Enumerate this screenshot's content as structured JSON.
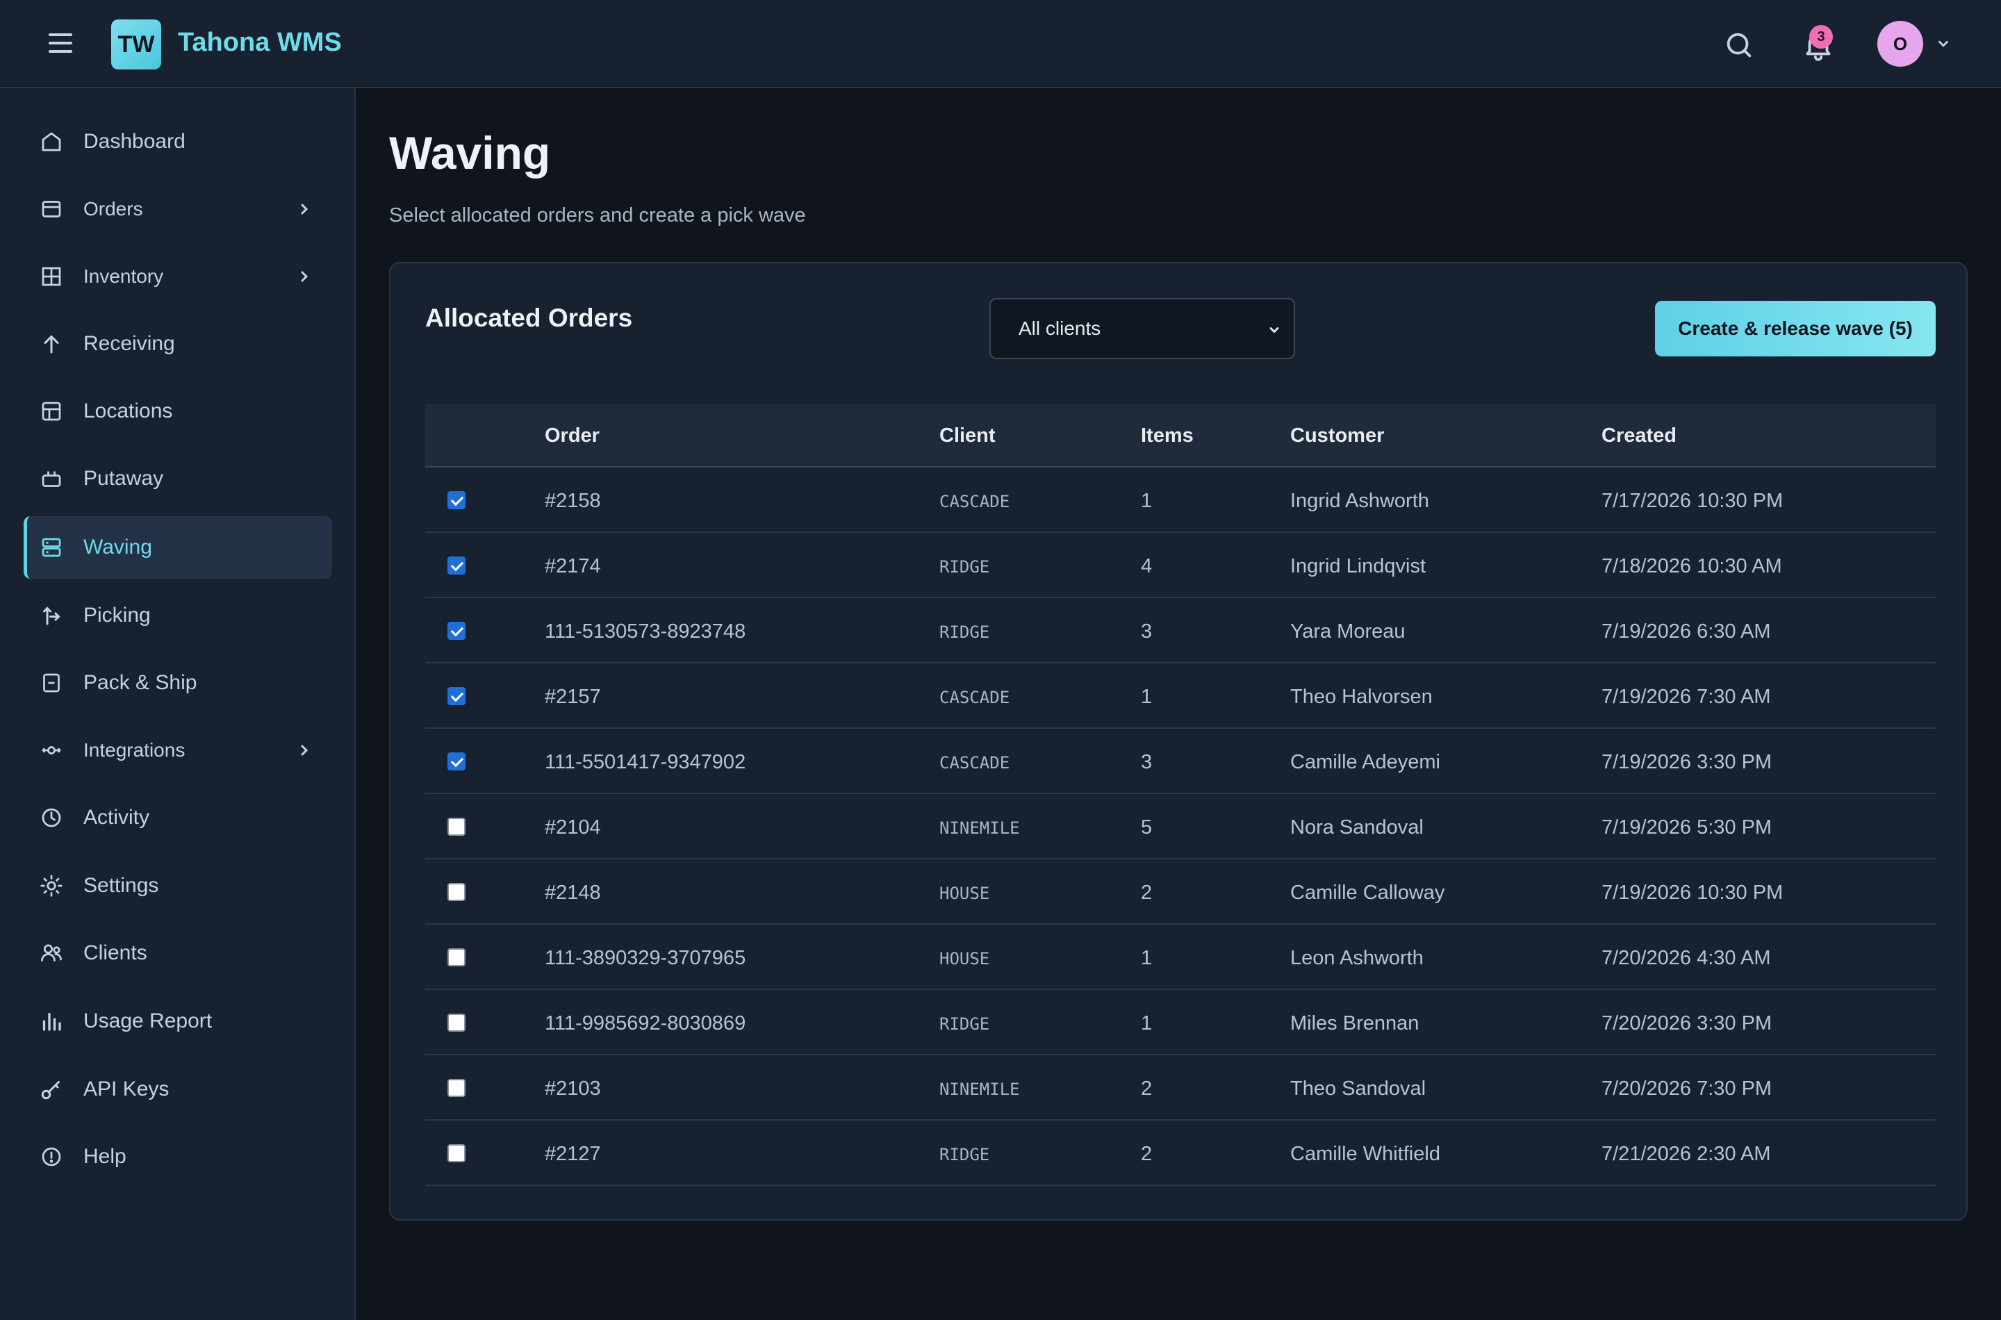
{
  "app": {
    "logo": "TW",
    "title": "Tahona WMS"
  },
  "header": {
    "notification_count": "3",
    "user_initial": "O",
    "icons": [
      "menu-icon",
      "search-icon",
      "bell-icon",
      "chevron-down-icon"
    ]
  },
  "sidebar": {
    "items": [
      {
        "label": "Dashboard",
        "icon": "home-icon",
        "expandable": false
      },
      {
        "label": "Orders",
        "icon": "orders-icon",
        "expandable": true
      },
      {
        "label": "Inventory",
        "icon": "grid-icon",
        "expandable": true
      },
      {
        "label": "Receiving",
        "icon": "arrow-up-icon",
        "expandable": false
      },
      {
        "label": "Locations",
        "icon": "layout-icon",
        "expandable": false
      },
      {
        "label": "Putaway",
        "icon": "tray-icon",
        "expandable": false
      },
      {
        "label": "Waving",
        "icon": "server-icon",
        "expandable": false,
        "active": true
      },
      {
        "label": "Picking",
        "icon": "arrows-icon",
        "expandable": false
      },
      {
        "label": "Pack & Ship",
        "icon": "box-icon",
        "expandable": false
      },
      {
        "label": "Integrations",
        "icon": "plug-icon",
        "expandable": true
      },
      {
        "label": "Activity",
        "icon": "clock-icon",
        "expandable": false
      },
      {
        "label": "Settings",
        "icon": "gear-icon",
        "expandable": false
      },
      {
        "label": "Clients",
        "icon": "users-icon",
        "expandable": false
      },
      {
        "label": "Usage Report",
        "icon": "bar-chart-icon",
        "expandable": false
      },
      {
        "label": "API Keys",
        "icon": "key-icon",
        "expandable": false
      },
      {
        "label": "Help",
        "icon": "help-icon",
        "expandable": false
      }
    ]
  },
  "main": {
    "title": "Waving",
    "subtitle": "Select allocated orders and create a pick wave",
    "card": {
      "title": "Allocated Orders",
      "client_filter": {
        "selected": "All clients"
      },
      "action_button": "Create & release wave (5)",
      "columns": [
        "Order",
        "Client",
        "Items",
        "Customer",
        "Created"
      ],
      "rows": [
        {
          "checked": true,
          "order": "#2158",
          "client": "CASCADE",
          "items": "1",
          "customer": "Ingrid Ashworth",
          "created": "7/17/2026 10:30 PM"
        },
        {
          "checked": true,
          "order": "#2174",
          "client": "RIDGE",
          "items": "4",
          "customer": "Ingrid Lindqvist",
          "created": "7/18/2026 10:30 AM"
        },
        {
          "checked": true,
          "order": "111-5130573-8923748",
          "client": "RIDGE",
          "items": "3",
          "customer": "Yara Moreau",
          "created": "7/19/2026 6:30 AM"
        },
        {
          "checked": true,
          "order": "#2157",
          "client": "CASCADE",
          "items": "1",
          "customer": "Theo Halvorsen",
          "created": "7/19/2026 7:30 AM"
        },
        {
          "checked": true,
          "order": "111-5501417-9347902",
          "client": "CASCADE",
          "items": "3",
          "customer": "Camille Adeyemi",
          "created": "7/19/2026 3:30 PM"
        },
        {
          "checked": false,
          "order": "#2104",
          "client": "NINEMILE",
          "items": "5",
          "customer": "Nora Sandoval",
          "created": "7/19/2026 5:30 PM"
        },
        {
          "checked": false,
          "order": "#2148",
          "client": "HOUSE",
          "items": "2",
          "customer": "Camille Calloway",
          "created": "7/19/2026 10:30 PM"
        },
        {
          "checked": false,
          "order": "111-3890329-3707965",
          "client": "HOUSE",
          "items": "1",
          "customer": "Leon Ashworth",
          "created": "7/20/2026 4:30 AM"
        },
        {
          "checked": false,
          "order": "111-9985692-8030869",
          "client": "RIDGE",
          "items": "1",
          "customer": "Miles Brennan",
          "created": "7/20/2026 3:30 PM"
        },
        {
          "checked": false,
          "order": "#2103",
          "client": "NINEMILE",
          "items": "2",
          "customer": "Theo Sandoval",
          "created": "7/20/2026 7:30 PM"
        },
        {
          "checked": false,
          "order": "#2127",
          "client": "RIDGE",
          "items": "2",
          "customer": "Camille Whitfield",
          "created": "7/21/2026 2:30 AM"
        }
      ]
    }
  },
  "colors": {
    "accent": "#5fd3e6",
    "background": "#10151d",
    "surface": "#182130",
    "badge": "#f06fb4"
  }
}
